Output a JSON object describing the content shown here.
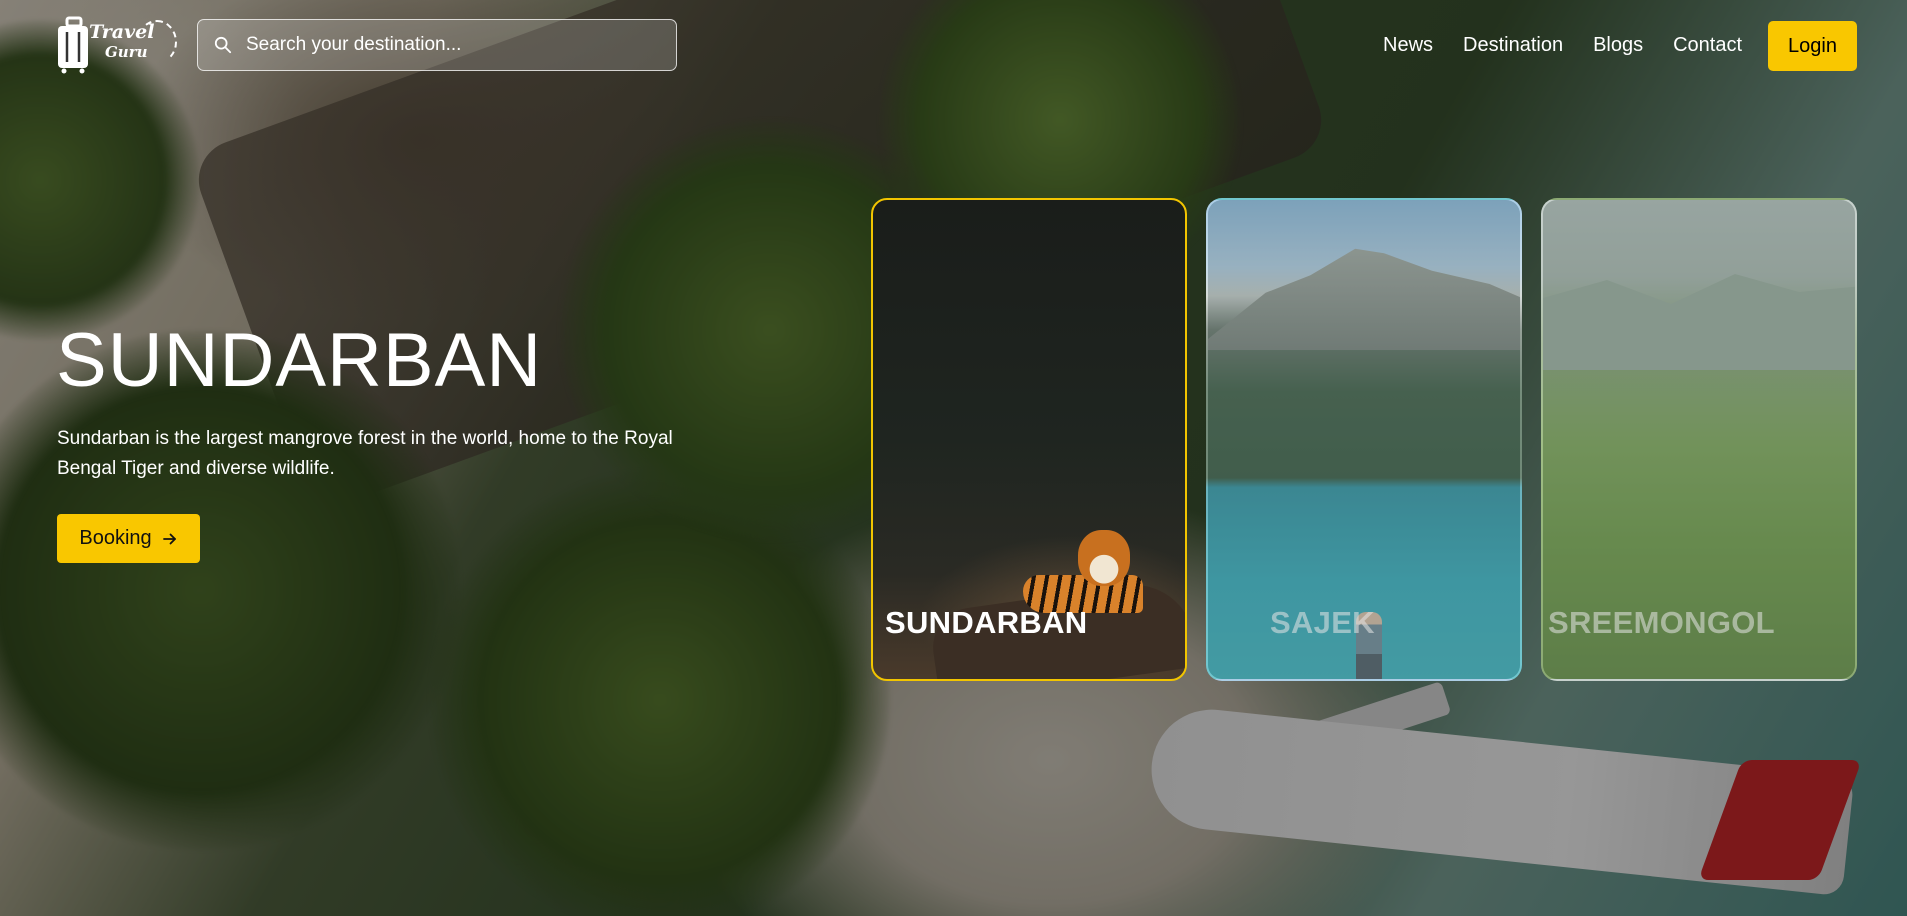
{
  "header": {
    "logo": {
      "line1": "Travel",
      "line2": "Guru"
    },
    "search": {
      "placeholder": "Search your destination..."
    },
    "nav": [
      "News",
      "Destination",
      "Blogs",
      "Contact"
    ],
    "login_label": "Login"
  },
  "hero": {
    "title": "SUNDARBAN",
    "description": "Sundarban is the largest mangrove forest in the world, home to the Royal Bengal Tiger and diverse wildlife.",
    "booking_label": "Booking"
  },
  "cards": [
    {
      "label": "SUNDARBAN",
      "active": true
    },
    {
      "label": "SAJEK",
      "active": false
    },
    {
      "label": "SREEMONGOL",
      "active": false
    }
  ],
  "colors": {
    "accent": "#f9c700",
    "active_border": "#f2c500"
  },
  "icons": {
    "logo": "suitcase-icon",
    "search": "search-icon",
    "booking": "arrow-right-icon"
  }
}
